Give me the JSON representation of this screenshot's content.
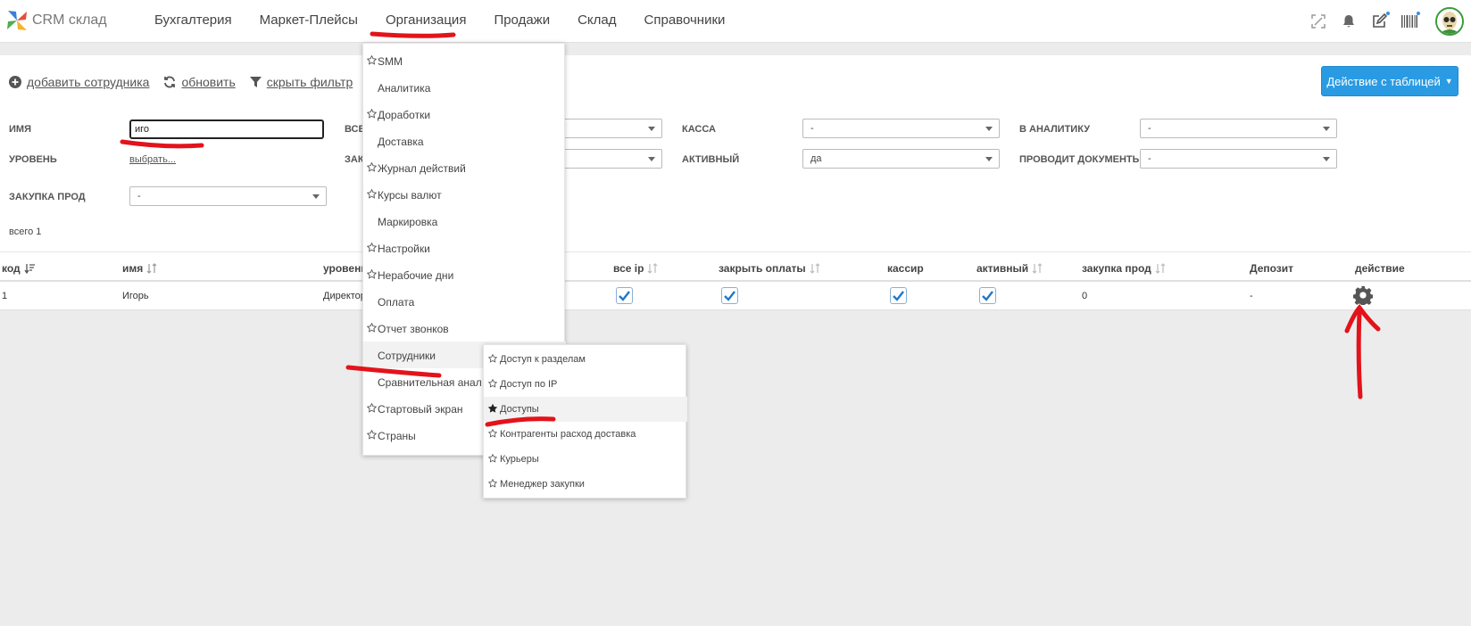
{
  "app": {
    "brand": "CRM склад"
  },
  "nav": {
    "items": [
      "Бухгалтерия",
      "Маркет-Плейсы",
      "Организация",
      "Продажи",
      "Склад",
      "Справочники"
    ]
  },
  "toolbar": {
    "add_employee": "добавить сотрудника",
    "refresh": "обновить",
    "hide_filter": "скрыть фильтр",
    "table_action": "Действие с таблицей"
  },
  "filters": {
    "name_label": "ИМЯ",
    "name_value": "иго",
    "level_label": "УРОВЕНЬ",
    "level_link": "выбрать...",
    "purchase_label": "ЗАКУПКА ПРОД",
    "purchase_value": "-",
    "all_ip_label": "ВСЕ",
    "close_label": "ЗАК",
    "cash_label": "КАССА",
    "cash_value": "-",
    "active_label": "АКТИВНЫЙ",
    "active_value": "да",
    "analytics_label": "В АНАЛИТИКУ",
    "analytics_value": "-",
    "docs_label": "ПРОВОДИТ ДОКУМЕНТЫ",
    "docs_value": "-",
    "total": "всего 1"
  },
  "table": {
    "headers": {
      "code": "код",
      "name": "имя",
      "level": "уровень",
      "all_ip": "все ip",
      "close_payments": "закрыть оплаты",
      "cashier": "кассир",
      "active": "активный",
      "purchase": "закупка прод",
      "deposit": "Депозит",
      "action": "действие"
    },
    "row": {
      "code": "1",
      "name": "Игорь",
      "level": "Директор",
      "all_ip": true,
      "close_payments": true,
      "cashier": true,
      "active": true,
      "purchase": "0",
      "deposit": "-"
    }
  },
  "dropdown": {
    "items": [
      {
        "label": "SMM",
        "star": true
      },
      {
        "label": "Аналитика",
        "star": false
      },
      {
        "label": "Доработки",
        "star": true
      },
      {
        "label": "Доставка",
        "star": false
      },
      {
        "label": "Журнал действий",
        "star": true
      },
      {
        "label": "Курсы валют",
        "star": true
      },
      {
        "label": "Маркировка",
        "star": false
      },
      {
        "label": "Настройки",
        "star": true
      },
      {
        "label": "Нерабочие дни",
        "star": true
      },
      {
        "label": "Оплата",
        "star": false
      },
      {
        "label": "Отчет звонков",
        "star": true
      },
      {
        "label": "Сотрудники",
        "star": false
      },
      {
        "label": "Сравнительная анал",
        "star": false
      },
      {
        "label": "Стартовый экран",
        "star": true
      },
      {
        "label": "Страны",
        "star": true
      }
    ],
    "active_index": 11
  },
  "submenu": {
    "items": [
      {
        "label": "Доступ к разделам",
        "filled": false
      },
      {
        "label": "Доступ по IP",
        "filled": false
      },
      {
        "label": "Доступы",
        "filled": true
      },
      {
        "label": "Контрагенты расход доставка",
        "filled": false
      },
      {
        "label": "Курьеры",
        "filled": false
      },
      {
        "label": "Менеджер закупки",
        "filled": false
      }
    ],
    "active_index": 2
  },
  "colors": {
    "accent": "#2a9be3",
    "checkbox": "#1e78c8",
    "annotation": "#e3131b"
  }
}
